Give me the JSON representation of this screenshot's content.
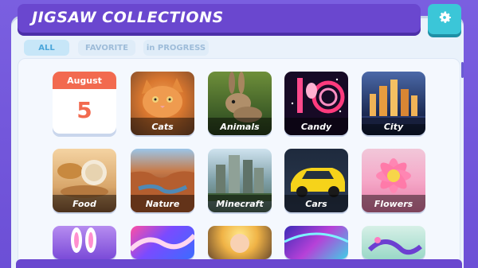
{
  "header": {
    "title": "JIGSAW COLLECTIONS"
  },
  "tabs": [
    {
      "label": "ALL"
    },
    {
      "label": "FAVORITE"
    },
    {
      "label": "in PROGRESS"
    }
  ],
  "calendar": {
    "month": "August",
    "day": "5"
  },
  "tiles": [
    {
      "label": "Cats",
      "icon": "cat-photo"
    },
    {
      "label": "Animals",
      "icon": "rabbit-photo"
    },
    {
      "label": "Candy",
      "icon": "candy-photo"
    },
    {
      "label": "City",
      "icon": "city-photo"
    },
    {
      "label": "Food",
      "icon": "food-photo"
    },
    {
      "label": "Nature",
      "icon": "canyon-photo"
    },
    {
      "label": "Minecraft",
      "icon": "minecraft-photo"
    },
    {
      "label": "Cars",
      "icon": "car-photo"
    },
    {
      "label": "Flowers",
      "icon": "flower-photo"
    }
  ],
  "colors": {
    "background": "#6c4fd6",
    "header": "#6a47cf",
    "settings": "#3bc6d8",
    "calendar_accent": "#f26a4f"
  }
}
